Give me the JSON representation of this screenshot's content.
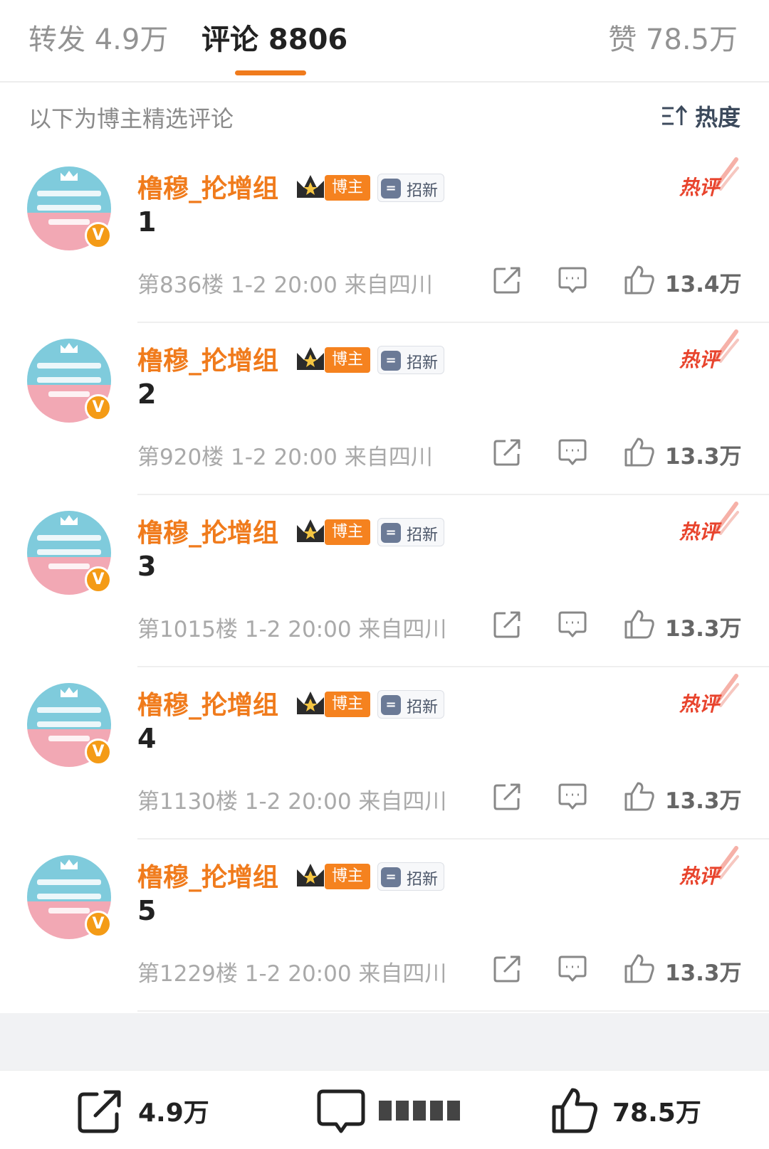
{
  "tabs": {
    "repost": "转发 4.9万",
    "comment": "评论 8806",
    "like": "赞 78.5万",
    "accent": "#f07b1c"
  },
  "filter": {
    "text": "以下为博主精选评论",
    "sort_label": "热度"
  },
  "comment_badges": {
    "blogger": "博主",
    "recruit": "招新",
    "hot": "热评",
    "verified": "V"
  },
  "comments": [
    {
      "user": "橹穆_抡增组",
      "text": "1",
      "meta": "第836楼 1-2 20:00 来自四川",
      "likes": "13.4万"
    },
    {
      "user": "橹穆_抡增组",
      "text": "2",
      "meta": "第920楼 1-2 20:00 来自四川",
      "likes": "13.3万"
    },
    {
      "user": "橹穆_抡增组",
      "text": "3",
      "meta": "第1015楼 1-2 20:00 来自四川",
      "likes": "13.3万"
    },
    {
      "user": "橹穆_抡增组",
      "text": "4",
      "meta": "第1130楼 1-2 20:00 来自四川",
      "likes": "13.3万"
    },
    {
      "user": "橹穆_抡增组",
      "text": "5",
      "meta": "第1229楼 1-2 20:00 来自四川",
      "likes": "13.3万"
    }
  ],
  "toolbar": {
    "repost_count": "4.9万",
    "like_count": "78.5万"
  },
  "icons": {
    "sort": "sort-icon",
    "share": "share-icon",
    "reply": "reply-icon",
    "like": "thumb-up-icon",
    "crown": "crown-icon"
  }
}
